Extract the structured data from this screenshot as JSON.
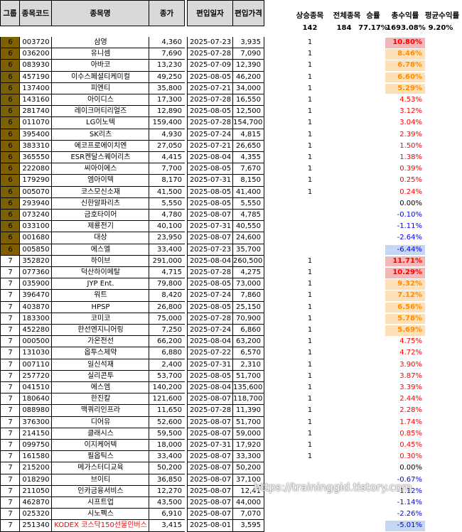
{
  "headers": {
    "group": "그룹",
    "code": "종목코드",
    "name": "종목명",
    "close": "종가",
    "date": "편입일자",
    "price": "편입가격"
  },
  "summary": {
    "labels": [
      "상승종목",
      "전체종목",
      "승률",
      "총수익률",
      "평균수익률"
    ],
    "values": [
      "142",
      "184",
      "77.17%",
      "1693.08%",
      "9.20%"
    ]
  },
  "rows": [
    {
      "group": "6",
      "code": "003720",
      "name": "삼영",
      "close": "4,360",
      "date": "2025-07-23",
      "price": "3,935",
      "up": "1",
      "ret": "10.80%",
      "tone": "red-hi"
    },
    {
      "group": "6",
      "code": "036200",
      "name": "유니셈",
      "close": "7,690",
      "date": "2025-07-28",
      "price": "7,090",
      "up": "1",
      "ret": "8.46%",
      "tone": "orange"
    },
    {
      "group": "6",
      "code": "083930",
      "name": "아바코",
      "close": "13,230",
      "date": "2025-07-09",
      "price": "12,390",
      "up": "1",
      "ret": "6.78%",
      "tone": "orange"
    },
    {
      "group": "6",
      "code": "457190",
      "name": "이수스페셜티케미컬",
      "close": "49,250",
      "date": "2025-08-05",
      "price": "46,200",
      "up": "1",
      "ret": "6.60%",
      "tone": "orange"
    },
    {
      "group": "6",
      "code": "137400",
      "name": "피엔티",
      "close": "35,800",
      "date": "2025-07-21",
      "price": "34,000",
      "up": "1",
      "ret": "5.29%",
      "tone": "orange"
    },
    {
      "group": "6",
      "code": "143160",
      "name": "아이디스",
      "close": "17,300",
      "date": "2025-07-28",
      "price": "16,550",
      "up": "1",
      "ret": "4.53%",
      "tone": "red"
    },
    {
      "group": "6",
      "code": "281740",
      "name": "레이크머티리얼즈",
      "close": "12,890",
      "date": "2025-08-05",
      "price": "12,500",
      "up": "1",
      "ret": "3.12%",
      "tone": "red"
    },
    {
      "group": "6",
      "code": "011070",
      "name": "LG이노텍",
      "close": "159,400",
      "date": "2025-07-28",
      "price": "154,700",
      "up": "1",
      "ret": "3.04%",
      "tone": "red"
    },
    {
      "group": "6",
      "code": "395400",
      "name": "SK리츠",
      "close": "4,930",
      "date": "2025-07-24",
      "price": "4,815",
      "up": "1",
      "ret": "2.39%",
      "tone": "red"
    },
    {
      "group": "6",
      "code": "383310",
      "name": "에코프로에이치엔",
      "close": "27,050",
      "date": "2025-07-21",
      "price": "26,650",
      "up": "1",
      "ret": "1.50%",
      "tone": "red"
    },
    {
      "group": "6",
      "code": "365550",
      "name": "ESR켄달스퀘어리츠",
      "close": "4,415",
      "date": "2025-08-04",
      "price": "4,355",
      "up": "1",
      "ret": "1.38%",
      "tone": "red"
    },
    {
      "group": "6",
      "code": "222080",
      "name": "씨아이에스",
      "close": "7,700",
      "date": "2025-08-05",
      "price": "7,670",
      "up": "1",
      "ret": "0.39%",
      "tone": "red"
    },
    {
      "group": "6",
      "code": "179290",
      "name": "엠아이텍",
      "close": "8,170",
      "date": "2025-07-31",
      "price": "8,150",
      "up": "1",
      "ret": "0.25%",
      "tone": "red"
    },
    {
      "group": "6",
      "code": "005070",
      "name": "코스모신소재",
      "close": "41,500",
      "date": "2025-08-05",
      "price": "41,400",
      "up": "1",
      "ret": "0.24%",
      "tone": "red"
    },
    {
      "group": "6",
      "code": "293940",
      "name": "신한알파리츠",
      "close": "5,550",
      "date": "2025-08-05",
      "price": "5,550",
      "up": "",
      "ret": "0.00%",
      "tone": "black"
    },
    {
      "group": "6",
      "code": "073240",
      "name": "금호타이어",
      "close": "4,780",
      "date": "2025-08-07",
      "price": "4,785",
      "up": "",
      "ret": "-0.10%",
      "tone": "blue"
    },
    {
      "group": "6",
      "code": "033100",
      "name": "제룡전기",
      "close": "40,100",
      "date": "2025-07-31",
      "price": "40,550",
      "up": "",
      "ret": "-1.11%",
      "tone": "blue"
    },
    {
      "group": "6",
      "code": "001680",
      "name": "대상",
      "close": "23,950",
      "date": "2025-08-07",
      "price": "24,600",
      "up": "",
      "ret": "-2.64%",
      "tone": "blue"
    },
    {
      "group": "6",
      "code": "005850",
      "name": "에스엘",
      "close": "33,400",
      "date": "2025-07-23",
      "price": "35,700",
      "up": "",
      "ret": "-6.44%",
      "tone": "blue-hi"
    },
    {
      "group": "7",
      "code": "352820",
      "name": "하이브",
      "close": "291,000",
      "date": "2025-08-04",
      "price": "260,500",
      "up": "1",
      "ret": "11.71%",
      "tone": "red-hi"
    },
    {
      "group": "7",
      "code": "077360",
      "name": "덕산하이메탈",
      "close": "4,715",
      "date": "2025-07-28",
      "price": "4,275",
      "up": "1",
      "ret": "10.29%",
      "tone": "red-hi"
    },
    {
      "group": "7",
      "code": "035900",
      "name": "JYP Ent.",
      "close": "79,800",
      "date": "2025-08-05",
      "price": "73,000",
      "up": "1",
      "ret": "9.32%",
      "tone": "orange"
    },
    {
      "group": "7",
      "code": "396470",
      "name": "워트",
      "close": "8,420",
      "date": "2025-07-24",
      "price": "7,860",
      "up": "1",
      "ret": "7.12%",
      "tone": "orange"
    },
    {
      "group": "7",
      "code": "403870",
      "name": "HPSP",
      "close": "26,800",
      "date": "2025-08-05",
      "price": "25,150",
      "up": "1",
      "ret": "6.56%",
      "tone": "orange"
    },
    {
      "group": "7",
      "code": "183300",
      "name": "코미코",
      "close": "75,000",
      "date": "2025-07-28",
      "price": "70,900",
      "up": "1",
      "ret": "5.78%",
      "tone": "orange"
    },
    {
      "group": "7",
      "code": "452280",
      "name": "한선엔지니어링",
      "close": "7,250",
      "date": "2025-07-24",
      "price": "6,860",
      "up": "1",
      "ret": "5.69%",
      "tone": "orange"
    },
    {
      "group": "7",
      "code": "000500",
      "name": "가온전선",
      "close": "66,200",
      "date": "2025-08-04",
      "price": "63,200",
      "up": "1",
      "ret": "4.75%",
      "tone": "red"
    },
    {
      "group": "7",
      "code": "131030",
      "name": "옵투스제약",
      "close": "6,880",
      "date": "2025-07-22",
      "price": "6,570",
      "up": "1",
      "ret": "4.72%",
      "tone": "red"
    },
    {
      "group": "7",
      "code": "007110",
      "name": "일신석재",
      "close": "2,400",
      "date": "2025-07-31",
      "price": "2,310",
      "up": "1",
      "ret": "3.90%",
      "tone": "red"
    },
    {
      "group": "7",
      "code": "257720",
      "name": "실리콘투",
      "close": "53,700",
      "date": "2025-08-05",
      "price": "51,700",
      "up": "1",
      "ret": "3.87%",
      "tone": "red"
    },
    {
      "group": "7",
      "code": "041510",
      "name": "에스엠",
      "close": "140,200",
      "date": "2025-08-04",
      "price": "135,600",
      "up": "1",
      "ret": "3.39%",
      "tone": "red"
    },
    {
      "group": "7",
      "code": "180640",
      "name": "한진칼",
      "close": "121,600",
      "date": "2025-08-07",
      "price": "118,700",
      "up": "1",
      "ret": "2.44%",
      "tone": "red"
    },
    {
      "group": "7",
      "code": "088980",
      "name": "맥쿼리인프라",
      "close": "11,650",
      "date": "2025-07-28",
      "price": "11,390",
      "up": "1",
      "ret": "2.28%",
      "tone": "red"
    },
    {
      "group": "7",
      "code": "376300",
      "name": "디어유",
      "close": "52,600",
      "date": "2025-08-07",
      "price": "51,700",
      "up": "1",
      "ret": "1.74%",
      "tone": "red"
    },
    {
      "group": "7",
      "code": "214150",
      "name": "클래시스",
      "close": "59,500",
      "date": "2025-08-07",
      "price": "59,000",
      "up": "1",
      "ret": "0.85%",
      "tone": "red"
    },
    {
      "group": "7",
      "code": "099750",
      "name": "이지케어텍",
      "close": "18,000",
      "date": "2025-07-31",
      "price": "17,920",
      "up": "1",
      "ret": "0.45%",
      "tone": "red"
    },
    {
      "group": "7",
      "code": "161580",
      "name": "필옵틱스",
      "close": "33,400",
      "date": "2025-08-07",
      "price": "33,300",
      "up": "1",
      "ret": "0.30%",
      "tone": "red"
    },
    {
      "group": "7",
      "code": "215200",
      "name": "메가스터디교육",
      "close": "50,200",
      "date": "2025-08-07",
      "price": "50,200",
      "up": "",
      "ret": "0.00%",
      "tone": "black"
    },
    {
      "group": "7",
      "code": "018290",
      "name": "브이티",
      "close": "36,850",
      "date": "2025-08-07",
      "price": "37,100",
      "up": "",
      "ret": "-0.67%",
      "tone": "blue"
    },
    {
      "group": "7",
      "code": "211050",
      "name": "인카금융서비스",
      "close": "12,270",
      "date": "2025-08-07",
      "price": "12,41",
      "up": "",
      "ret": "-1.12%",
      "tone": "blue"
    },
    {
      "group": "7",
      "code": "462870",
      "name": "시프트업",
      "close": "43,500",
      "date": "2025-08-07",
      "price": "44,000",
      "up": "",
      "ret": "-1.14%",
      "tone": "blue"
    },
    {
      "group": "7",
      "code": "025320",
      "name": "시노펙스",
      "close": "6,910",
      "date": "2025-08-07",
      "price": "7,070",
      "up": "",
      "ret": "-2.26%",
      "tone": "blue"
    },
    {
      "group": "7",
      "code": "251340",
      "name": "KODEX 코스닥150선물인버스",
      "close": "3,415",
      "date": "2025-08-01",
      "price": "3,595",
      "up": "",
      "ret": "-5.01%",
      "tone": "blue-hi",
      "name_color": "red"
    }
  ],
  "colors": {
    "header_bg": "#d9d9d9",
    "group6_bg": "#7f6000",
    "red_text": "#ff0000",
    "blue_text": "#0000ff",
    "red_hi_bg": "#f4b6b6",
    "orange_hi_bg": "#fde0b8",
    "orange_text": "#ff8c00",
    "blue_hi_bg": "#c6d6f5"
  },
  "watermark": "https://traininggid.tistory.com"
}
